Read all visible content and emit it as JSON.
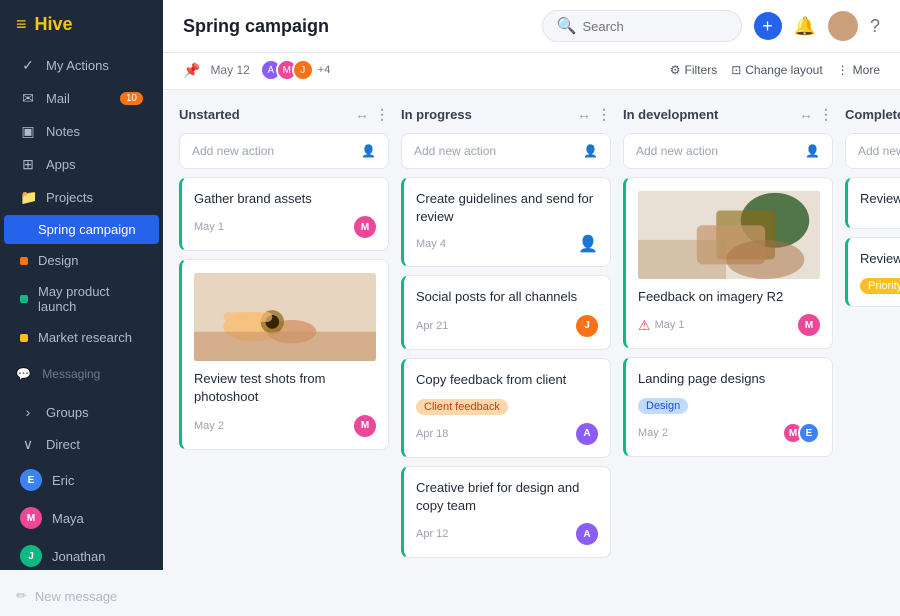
{
  "app": {
    "logo": "≡Hive",
    "logo_icon": "≡"
  },
  "sidebar": {
    "nav_items": [
      {
        "id": "my-actions",
        "label": "My Actions",
        "icon": "✓",
        "badge": null
      },
      {
        "id": "mail",
        "label": "Mail",
        "icon": "✉",
        "badge": "10"
      },
      {
        "id": "notes",
        "label": "Notes",
        "icon": "▣",
        "badge": null
      },
      {
        "id": "apps",
        "label": "Apps",
        "icon": "⊞",
        "badge": null
      },
      {
        "id": "projects",
        "label": "Projects",
        "icon": "📁",
        "badge": null
      }
    ],
    "projects": [
      {
        "id": "spring-campaign",
        "label": "Spring campaign",
        "color": "#2563eb",
        "active": true
      },
      {
        "id": "design",
        "label": "Design",
        "color": "#f97316",
        "active": false
      },
      {
        "id": "may-product-launch",
        "label": "May product launch",
        "color": "#10b981",
        "active": false
      },
      {
        "id": "market-research",
        "label": "Market research",
        "color": "#fbbf24",
        "active": false
      }
    ],
    "messaging": "Messaging",
    "groups": "Groups",
    "direct": "Direct",
    "direct_users": [
      {
        "id": "eric",
        "label": "Eric",
        "color": "#3b82f6"
      },
      {
        "id": "maya",
        "label": "Maya",
        "color": "#ec4899"
      },
      {
        "id": "jonathan",
        "label": "Jonathan",
        "color": "#10b981"
      }
    ],
    "new_message": "New message"
  },
  "header": {
    "title": "Spring campaign",
    "search_placeholder": "Search",
    "filters": "Filters",
    "change_layout": "Change layout",
    "more": "More"
  },
  "sub_header": {
    "date": "May 12",
    "plus_count": "+4"
  },
  "board": {
    "columns": [
      {
        "id": "unstarted",
        "label": "Unstarted",
        "add_label": "Add new action",
        "cards": [
          {
            "id": "c1",
            "title": "Gather brand assets",
            "date": "May 1",
            "image": false
          },
          {
            "id": "c2",
            "title": "Review test shots from photoshoot",
            "date": "May 2",
            "image": true
          }
        ]
      },
      {
        "id": "in-progress",
        "label": "In progress",
        "add_label": "Add new action",
        "cards": [
          {
            "id": "c3",
            "title": "Create guidelines and send for review",
            "date": "May 4",
            "image": false
          },
          {
            "id": "c4",
            "title": "Social posts for all channels",
            "date": "Apr 21",
            "image": false
          },
          {
            "id": "c5",
            "title": "Copy feedback from client",
            "date": "Apr 18",
            "image": false,
            "badge": "Client feedback",
            "badge_type": "orange"
          },
          {
            "id": "c6",
            "title": "Creative brief for design and copy team",
            "date": "Apr 12",
            "image": false
          }
        ]
      },
      {
        "id": "in-development",
        "label": "In development",
        "add_label": "Add new action",
        "cards": [
          {
            "id": "c7",
            "title": "Feedback on imagery R2",
            "date": "May 1",
            "image": true,
            "warning": true
          },
          {
            "id": "c8",
            "title": "Landing page designs",
            "date": "May 2",
            "image": false,
            "badge": "Design",
            "badge_type": "blue"
          }
        ]
      },
      {
        "id": "complete",
        "label": "Complete",
        "add_label": "Add new a...",
        "cards": [
          {
            "id": "c9",
            "title": "Review co...",
            "date": "",
            "image": false
          },
          {
            "id": "c10",
            "title": "Review te...",
            "date": "",
            "image": false,
            "badge": "Priority",
            "badge_type": "priority"
          }
        ]
      }
    ]
  }
}
